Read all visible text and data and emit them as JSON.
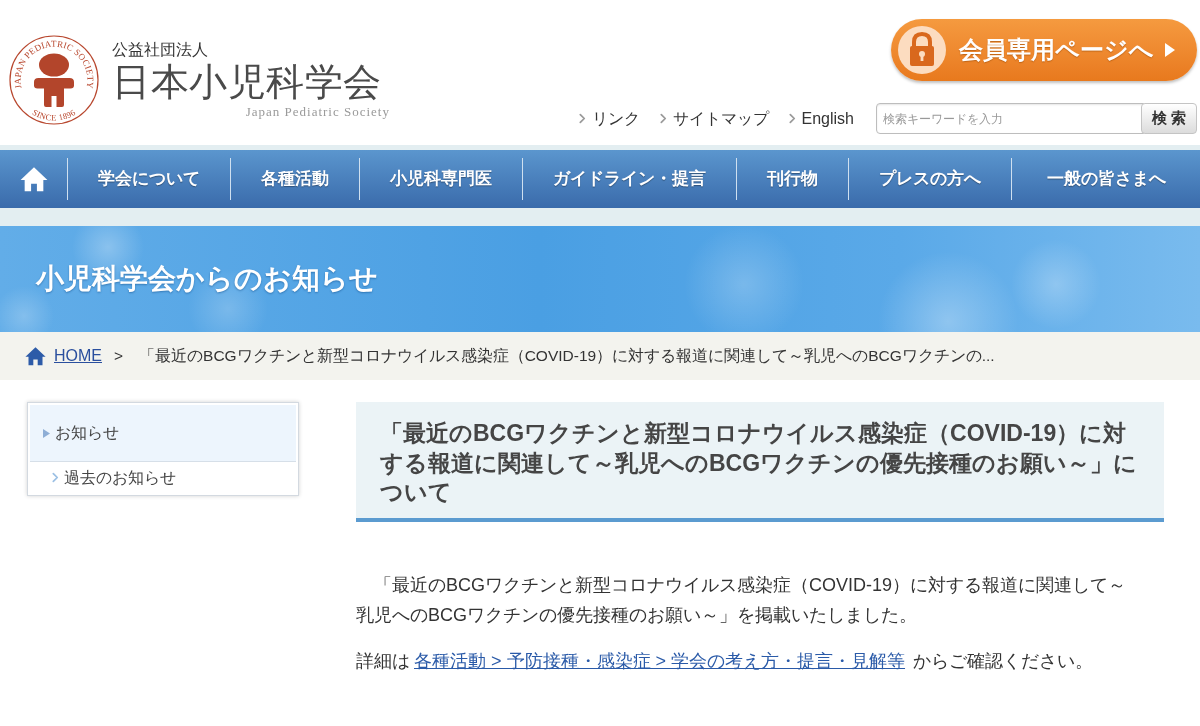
{
  "header": {
    "logo": {
      "ring_text": "JAPAN PEDIATRIC SOCIETY",
      "since_text": "SINCE 1896"
    },
    "org_type": "公益社団法人",
    "org_name": "日本小児科学会",
    "org_name_en": "Japan Pediatric Society",
    "member_button": "会員専用ページへ",
    "links": [
      "リンク",
      "サイトマップ",
      "English"
    ],
    "search": {
      "placeholder": "検索キーワードを入力",
      "button": "検 索"
    }
  },
  "nav": {
    "items": [
      "学会について",
      "各種活動",
      "小児科専門医",
      "ガイドライン・提言",
      "刊行物",
      "プレスの方へ",
      "一般の皆さまへ"
    ]
  },
  "banner": {
    "title": "小児科学会からのお知らせ"
  },
  "breadcrumb": {
    "home": "HOME",
    "separator": ">",
    "current": "「最近のBCGワクチンと新型コロナウイルス感染症（COVID-19）に対する報道に関連して～乳児へのBCGワクチンの..."
  },
  "sidebar": {
    "items": [
      {
        "label": "お知らせ",
        "selected": true,
        "children": [
          {
            "label": "過去のお知らせ",
            "selected": false
          }
        ]
      }
    ]
  },
  "article": {
    "title": "「最近のBCGワクチンと新型コロナウイルス感染症（COVID-19）に対する報道に関連して～乳児へのBCGワクチンの優先接種のお願い～」について",
    "body": "「最近のBCGワクチンと新型コロナウイルス感染症（COVID-19）に対する報道に関連して～乳児へのBCGワクチンの優先接種のお願い～」を掲載いたしました。",
    "detail": {
      "before": "詳細は",
      "link": "各種活動 > 予防接種・感染症 > 学会の考え方・提言・見解等",
      "after": "からご確認ください。"
    }
  }
}
